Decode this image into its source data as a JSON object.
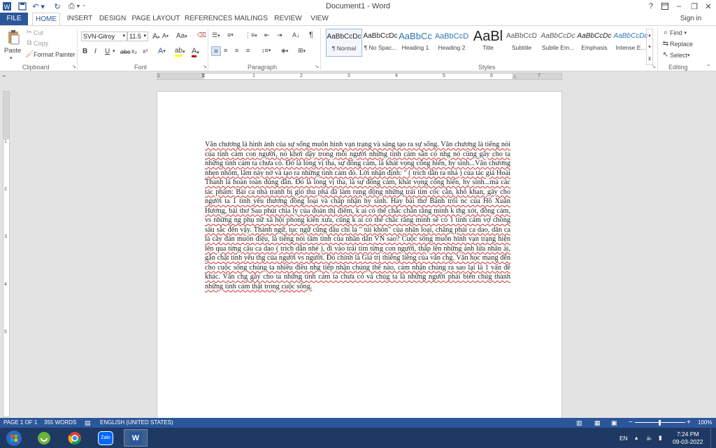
{
  "window": {
    "title": "Document1 - Word",
    "help": "?",
    "minimize": "–",
    "restore": "❐",
    "close": "✕",
    "sign_in": "Sign in"
  },
  "tabs": {
    "file": "FILE",
    "home": "HOME",
    "insert": "INSERT",
    "design": "DESIGN",
    "page_layout": "PAGE LAYOUT",
    "references": "REFERENCES",
    "mailings": "MAILINGS",
    "review": "REVIEW",
    "view": "VIEW"
  },
  "clipboard": {
    "paste": "Paste",
    "cut": "Cut",
    "copy": "Copy",
    "format_painter": "Format Painter",
    "group": "Clipboard"
  },
  "font": {
    "name": "SVN-Gilroy",
    "size": "11.5",
    "group": "Font",
    "bold": "B",
    "italic": "I",
    "underline": "U",
    "strike": "abc",
    "subscript": "x₂",
    "superscript": "x²",
    "grow": "A",
    "shrink": "A",
    "case": "Aa",
    "color_accent": "#c00000"
  },
  "paragraph": {
    "group": "Paragraph"
  },
  "styles": {
    "group": "Styles",
    "items": [
      {
        "preview": "AaBbCcDc",
        "name": "¶ Normal"
      },
      {
        "preview": "AaBbCcDc",
        "name": "¶ No Spac..."
      },
      {
        "preview": "AaBbCc",
        "name": "Heading 1"
      },
      {
        "preview": "AaBbCcD",
        "name": "Heading 2"
      },
      {
        "preview": "AaBl",
        "name": "Title"
      },
      {
        "preview": "AaBbCcD",
        "name": "Subtitle"
      },
      {
        "preview": "AaBbCcDc",
        "name": "Subtle Em..."
      },
      {
        "preview": "AaBbCcDc",
        "name": "Emphasis"
      },
      {
        "preview": "AaBbCcDc",
        "name": "Intense E..."
      }
    ]
  },
  "editing": {
    "find": "Find",
    "replace": "Replace",
    "select": "Select",
    "group": "Editing"
  },
  "ruler": {
    "h_ticks": [
      "1",
      "1",
      "2",
      "3",
      "4",
      "5",
      "6",
      "7"
    ],
    "v_ticks": [
      "1",
      "2",
      "3",
      "4",
      "5"
    ]
  },
  "document": {
    "text": "Văn chương là hình ảnh của sự sống muôn hình vạn trạng và sáng tạo ra sự sống. Văn chương là tiếng nói của tình cảm con người, nó khơi dậy trong mỗi người những tình cảm sẵn có nhg nó cũng gây cho ta những tình cảm ta chưa có. Đó là lòng vị tha, sự đồng cảm, là khát vọng cống hiến, hy sinh...Văn chương nhẹn nhõm, lâm này nở và tạo ra những tình cảm đó. Lời nhận định: \" ( trích dẫn ra nhá ) của tác giả Hoài Thanh là hoàn toàn đúng đắn. Đó là lòng vị tha, là sự đồng cảm, khát vọng cống hiến, hy sinh...mà các tác phẩm: Bài ca nhà tranh bị gió thu phá đã làm rung động những trái tim cốc cằn, khô khan, gây cho người ta 1 tình yêu thương đồng loại và chấp nhận hy sinh. Hay bài thơ Bánh trôi nc của Hồ Xuân Hương, bài thơ Sau phút chia ly của đoàn thị điểm, k ai có thể chắc chắn rằng mình k thg xót, đồng cảm, vs những ng phụ nữ xã hội phong kiến xưa, cũng k ai có thể chắc rằng mình sẽ có 1 tình cảm vợ chồng sâu sắc đến vậy. Thành ngữ, tục ngữ cũng đâu chỉ là \" túi khôn\" của nhân loại, chẳng phải ca dao, dân ca là cây đàn muôn điệu, là tiếng nói tâm tình của nhân dân VN sao? Cuộc sống muôn hình vạn trạng hiện lên qua từng câu ca dao ( trích dẫn nhé ), đi vào trái tim từng con người, thắp lên những ánh lửa nhân ái, gắn chặt tình yêu thg của người vs người. Đó chính là Giá trị thiêng liêng của văn chg. Văn học mang đến cho cuộc sống chúng ta nhiều điều nhg tiếp nhận chúng thế nào, cảm nhận chúng ra sao lại là 1 vấn đề khác. Văn chg gây cho ta những tình cảm ta chưa có và chúg ta là những người phải biến chúg thành những tình cảm thật trong cuộc sống."
  },
  "status": {
    "page": "PAGE 1 OF 1",
    "words": "355 WORDS",
    "language": "ENGLISH (UNITED STATES)",
    "zoom": "100%",
    "zoom_minus": "−",
    "zoom_plus": "+"
  },
  "taskbar": {
    "lang": "EN",
    "time": "7:24 PM",
    "date": "09-03-2022",
    "zalo": "Zalo",
    "word": "W"
  },
  "colors": {
    "word_blue": "#2b579a",
    "taskbar": "#1e3a63",
    "spell_underline": "#d03030"
  }
}
